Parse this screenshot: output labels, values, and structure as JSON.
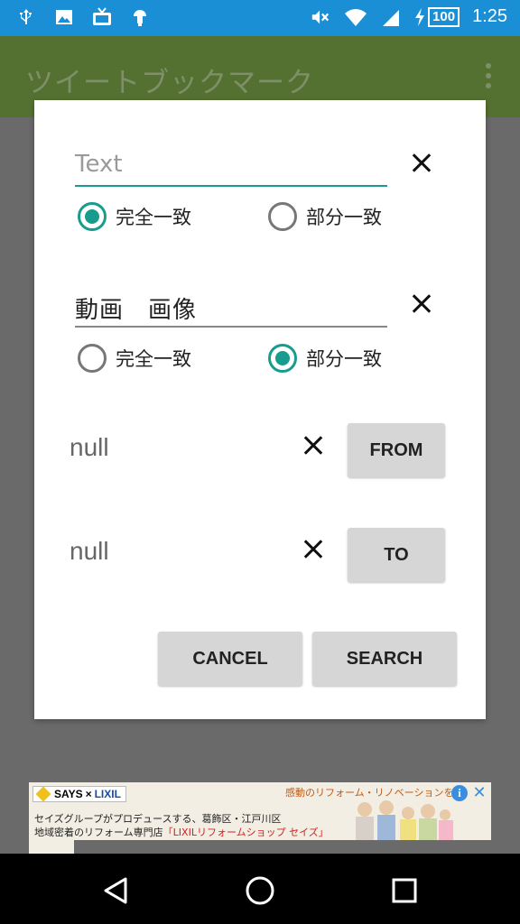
{
  "status_bar": {
    "icons": [
      "usb-icon",
      "image-icon",
      "tv-icon",
      "android-icon"
    ],
    "right_icons": [
      "mute-icon",
      "wifi-icon",
      "signal-icon",
      "charging-icon"
    ],
    "battery": "100",
    "time": "1:25",
    "color": "#1b8fd6"
  },
  "app_bar": {
    "title": "ツイートブックマーク",
    "color": "#557131"
  },
  "dialog": {
    "text_filter": {
      "placeholder": "Text",
      "value": "",
      "option_exact": "完全一致",
      "option_partial": "部分一致",
      "selected": "exact"
    },
    "media_filter": {
      "value": "動画　画像",
      "option_exact": "完全一致",
      "option_partial": "部分一致",
      "selected": "partial"
    },
    "from": {
      "value": "null",
      "button": "FROM"
    },
    "to": {
      "value": "null",
      "button": "TO"
    },
    "cancel_label": "CANCEL",
    "search_label": "SEARCH",
    "accent_color": "#179c8e"
  },
  "ad": {
    "logo_says": "SAYS",
    "logo_x": "×",
    "logo_lixil": "LIXIL",
    "headline": "感動のリフォーム・リノベーションをご",
    "line1": "セイズグループがプロデュースする、葛飾区・江戸川区",
    "line2_prefix": "地域密着のリフォーム専門店",
    "line2_highlight": "「LIXILリフォームショップ セイズ」",
    "info": "i",
    "close": "✕"
  },
  "nav_bar": {
    "buttons": [
      "back-icon",
      "home-icon",
      "recents-icon"
    ]
  }
}
